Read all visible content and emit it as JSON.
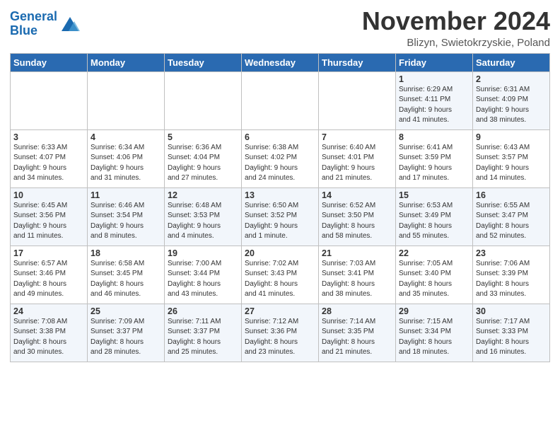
{
  "header": {
    "logo_line1": "General",
    "logo_line2": "Blue",
    "month_title": "November 2024",
    "location": "Blizyn, Swietokrzyskie, Poland"
  },
  "days_of_week": [
    "Sunday",
    "Monday",
    "Tuesday",
    "Wednesday",
    "Thursday",
    "Friday",
    "Saturday"
  ],
  "weeks": [
    [
      {
        "day": "",
        "info": ""
      },
      {
        "day": "",
        "info": ""
      },
      {
        "day": "",
        "info": ""
      },
      {
        "day": "",
        "info": ""
      },
      {
        "day": "",
        "info": ""
      },
      {
        "day": "1",
        "info": "Sunrise: 6:29 AM\nSunset: 4:11 PM\nDaylight: 9 hours\nand 41 minutes."
      },
      {
        "day": "2",
        "info": "Sunrise: 6:31 AM\nSunset: 4:09 PM\nDaylight: 9 hours\nand 38 minutes."
      }
    ],
    [
      {
        "day": "3",
        "info": "Sunrise: 6:33 AM\nSunset: 4:07 PM\nDaylight: 9 hours\nand 34 minutes."
      },
      {
        "day": "4",
        "info": "Sunrise: 6:34 AM\nSunset: 4:06 PM\nDaylight: 9 hours\nand 31 minutes."
      },
      {
        "day": "5",
        "info": "Sunrise: 6:36 AM\nSunset: 4:04 PM\nDaylight: 9 hours\nand 27 minutes."
      },
      {
        "day": "6",
        "info": "Sunrise: 6:38 AM\nSunset: 4:02 PM\nDaylight: 9 hours\nand 24 minutes."
      },
      {
        "day": "7",
        "info": "Sunrise: 6:40 AM\nSunset: 4:01 PM\nDaylight: 9 hours\nand 21 minutes."
      },
      {
        "day": "8",
        "info": "Sunrise: 6:41 AM\nSunset: 3:59 PM\nDaylight: 9 hours\nand 17 minutes."
      },
      {
        "day": "9",
        "info": "Sunrise: 6:43 AM\nSunset: 3:57 PM\nDaylight: 9 hours\nand 14 minutes."
      }
    ],
    [
      {
        "day": "10",
        "info": "Sunrise: 6:45 AM\nSunset: 3:56 PM\nDaylight: 9 hours\nand 11 minutes."
      },
      {
        "day": "11",
        "info": "Sunrise: 6:46 AM\nSunset: 3:54 PM\nDaylight: 9 hours\nand 8 minutes."
      },
      {
        "day": "12",
        "info": "Sunrise: 6:48 AM\nSunset: 3:53 PM\nDaylight: 9 hours\nand 4 minutes."
      },
      {
        "day": "13",
        "info": "Sunrise: 6:50 AM\nSunset: 3:52 PM\nDaylight: 9 hours\nand 1 minute."
      },
      {
        "day": "14",
        "info": "Sunrise: 6:52 AM\nSunset: 3:50 PM\nDaylight: 8 hours\nand 58 minutes."
      },
      {
        "day": "15",
        "info": "Sunrise: 6:53 AM\nSunset: 3:49 PM\nDaylight: 8 hours\nand 55 minutes."
      },
      {
        "day": "16",
        "info": "Sunrise: 6:55 AM\nSunset: 3:47 PM\nDaylight: 8 hours\nand 52 minutes."
      }
    ],
    [
      {
        "day": "17",
        "info": "Sunrise: 6:57 AM\nSunset: 3:46 PM\nDaylight: 8 hours\nand 49 minutes."
      },
      {
        "day": "18",
        "info": "Sunrise: 6:58 AM\nSunset: 3:45 PM\nDaylight: 8 hours\nand 46 minutes."
      },
      {
        "day": "19",
        "info": "Sunrise: 7:00 AM\nSunset: 3:44 PM\nDaylight: 8 hours\nand 43 minutes."
      },
      {
        "day": "20",
        "info": "Sunrise: 7:02 AM\nSunset: 3:43 PM\nDaylight: 8 hours\nand 41 minutes."
      },
      {
        "day": "21",
        "info": "Sunrise: 7:03 AM\nSunset: 3:41 PM\nDaylight: 8 hours\nand 38 minutes."
      },
      {
        "day": "22",
        "info": "Sunrise: 7:05 AM\nSunset: 3:40 PM\nDaylight: 8 hours\nand 35 minutes."
      },
      {
        "day": "23",
        "info": "Sunrise: 7:06 AM\nSunset: 3:39 PM\nDaylight: 8 hours\nand 33 minutes."
      }
    ],
    [
      {
        "day": "24",
        "info": "Sunrise: 7:08 AM\nSunset: 3:38 PM\nDaylight: 8 hours\nand 30 minutes."
      },
      {
        "day": "25",
        "info": "Sunrise: 7:09 AM\nSunset: 3:37 PM\nDaylight: 8 hours\nand 28 minutes."
      },
      {
        "day": "26",
        "info": "Sunrise: 7:11 AM\nSunset: 3:37 PM\nDaylight: 8 hours\nand 25 minutes."
      },
      {
        "day": "27",
        "info": "Sunrise: 7:12 AM\nSunset: 3:36 PM\nDaylight: 8 hours\nand 23 minutes."
      },
      {
        "day": "28",
        "info": "Sunrise: 7:14 AM\nSunset: 3:35 PM\nDaylight: 8 hours\nand 21 minutes."
      },
      {
        "day": "29",
        "info": "Sunrise: 7:15 AM\nSunset: 3:34 PM\nDaylight: 8 hours\nand 18 minutes."
      },
      {
        "day": "30",
        "info": "Sunrise: 7:17 AM\nSunset: 3:33 PM\nDaylight: 8 hours\nand 16 minutes."
      }
    ]
  ]
}
